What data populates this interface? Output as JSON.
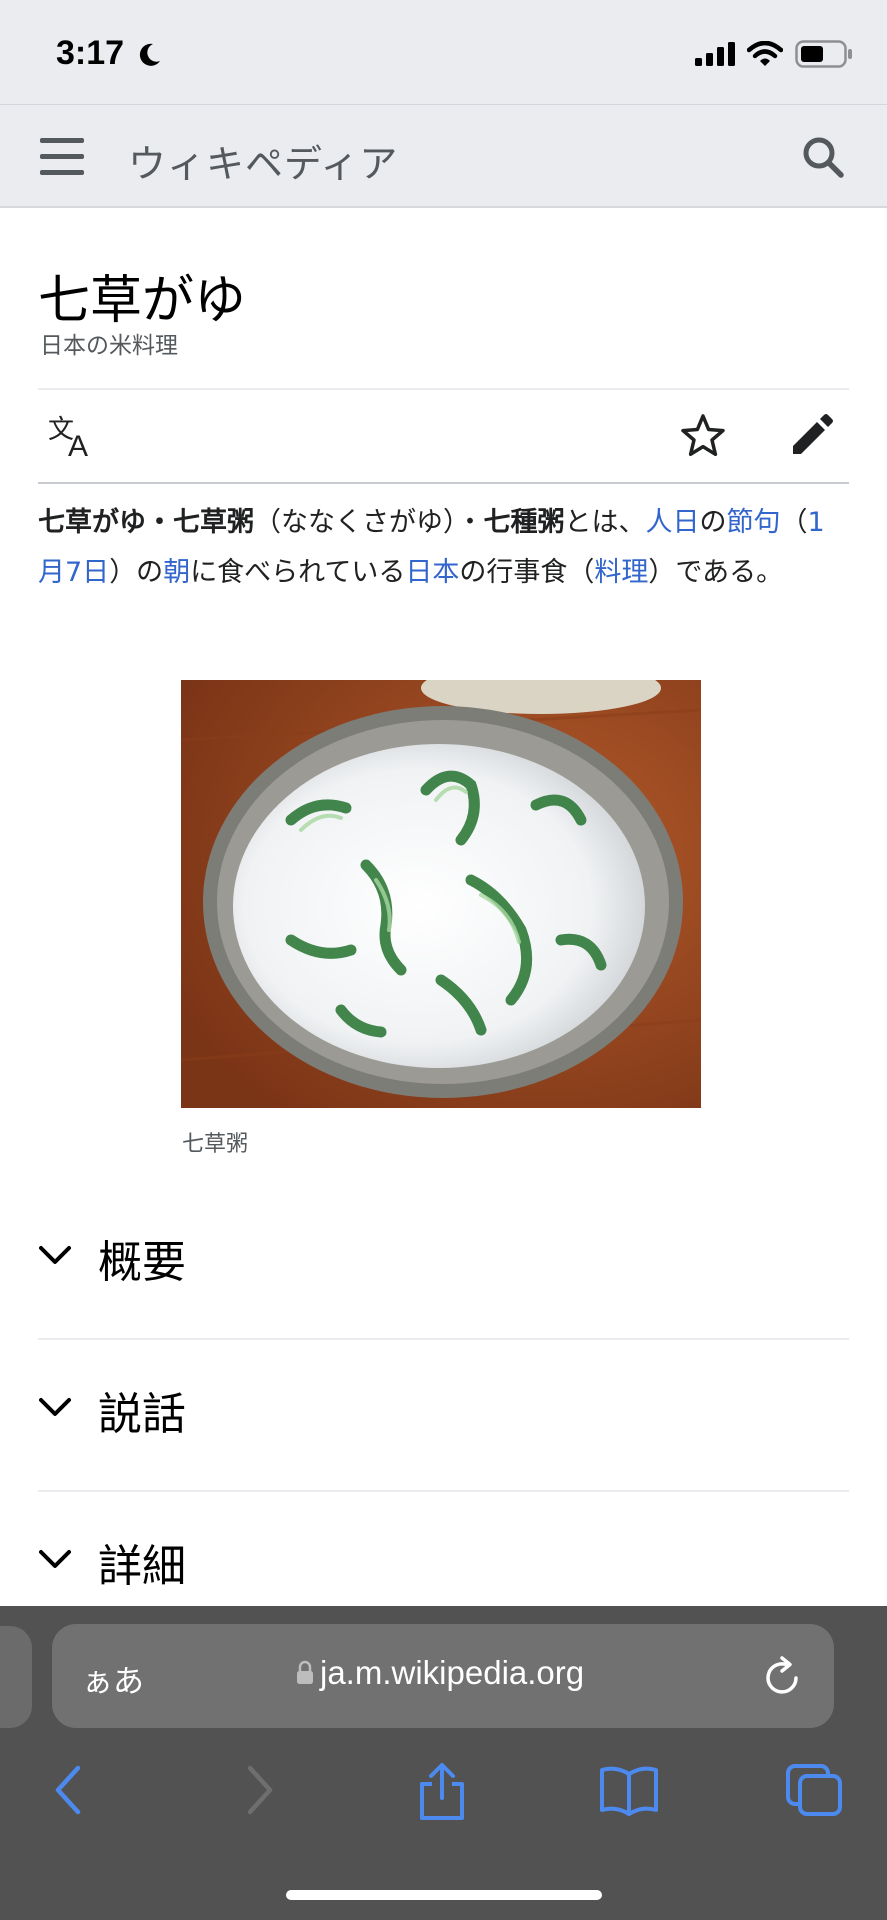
{
  "status": {
    "time": "3:17"
  },
  "header": {
    "wordmark": "ウィキペディア"
  },
  "article": {
    "title": "七草がゆ",
    "description": "日本の米料理",
    "lead": [
      {
        "t": "七草がゆ・七草粥",
        "s": "b"
      },
      {
        "t": "（ななくさがゆ）・",
        "s": ""
      },
      {
        "t": "七種粥",
        "s": "b"
      },
      {
        "t": "とは、",
        "s": ""
      },
      {
        "t": "人日",
        "s": "a"
      },
      {
        "t": "の",
        "s": ""
      },
      {
        "t": "節句",
        "s": "a"
      },
      {
        "t": "（",
        "s": ""
      },
      {
        "t": "1月7日",
        "s": "a"
      },
      {
        "t": "）の",
        "s": ""
      },
      {
        "t": "朝",
        "s": "a"
      },
      {
        "t": "に食べられている",
        "s": ""
      },
      {
        "t": "日本",
        "s": "a"
      },
      {
        "t": "の行事食（",
        "s": ""
      },
      {
        "t": "料理",
        "s": "a"
      },
      {
        "t": "）である。",
        "s": ""
      }
    ],
    "image_caption": "七草粥",
    "sections": [
      "概要",
      "説話",
      "詳細"
    ]
  },
  "browser": {
    "text_size_label": "ぁあ",
    "url": "ja.m.wikipedia.org"
  },
  "colors": {
    "link": "#3366cc",
    "header_bg": "#eaecf0",
    "toolbar_bg": "#525252",
    "toolbar_icon": "#4d8af0"
  }
}
